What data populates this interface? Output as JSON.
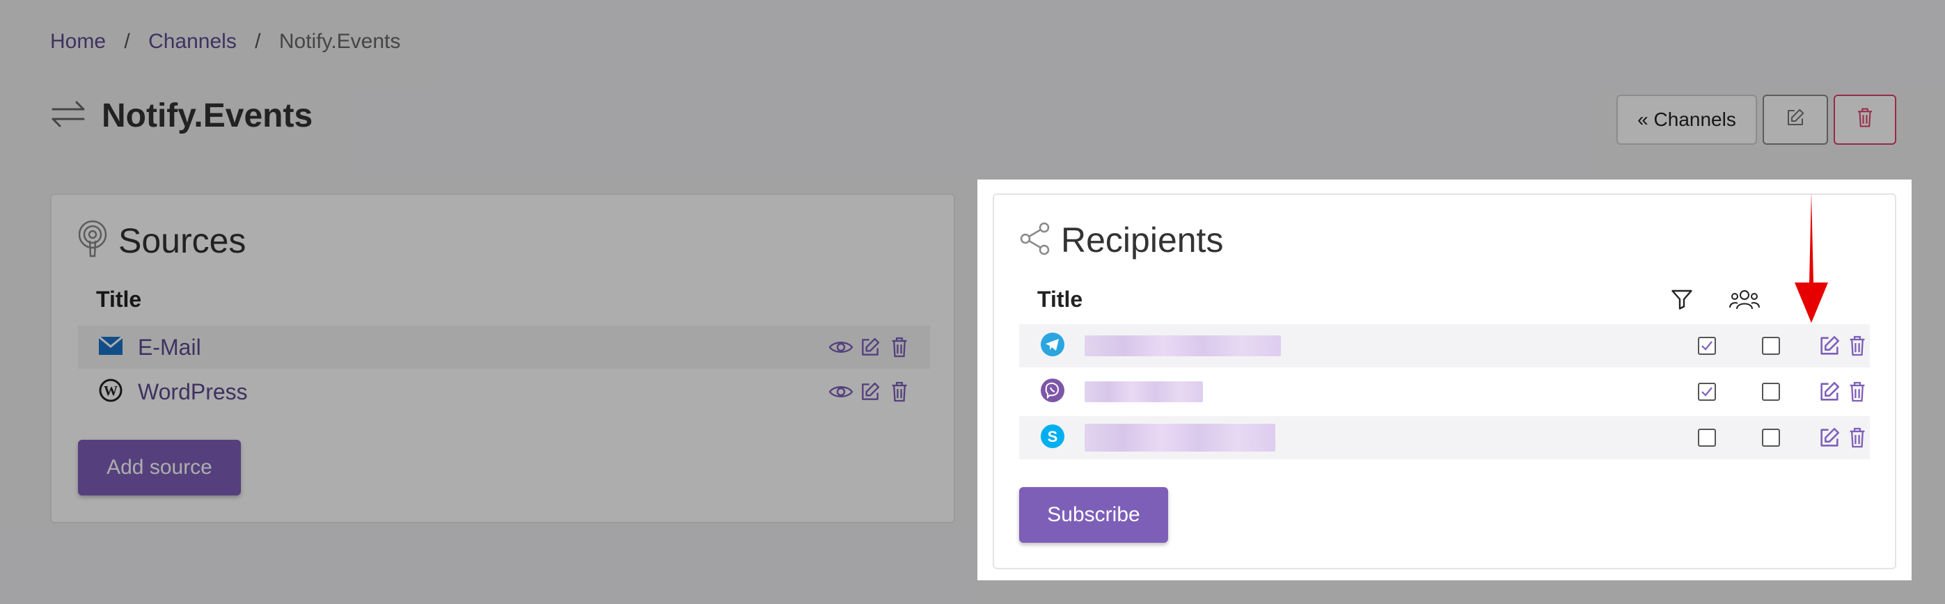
{
  "breadcrumb": {
    "home": "Home",
    "channels": "Channels",
    "current": "Notify.Events",
    "sep": "/"
  },
  "page": {
    "title": "Notify.Events",
    "icon": "arrows-exchange-icon"
  },
  "toolbar": {
    "channels_label": "« Channels",
    "edit_icon": "edit-icon",
    "delete_icon": "trash-icon",
    "delete_color": "#e0406a"
  },
  "sources": {
    "title": "Sources",
    "column_title": "Title",
    "items": [
      {
        "label": "E-Mail",
        "icon": "email-icon"
      },
      {
        "label": "WordPress",
        "icon": "wordpress-icon"
      }
    ],
    "add_label": "Add source"
  },
  "recipients": {
    "title": "Recipients",
    "column_title": "Title",
    "items": [
      {
        "service": "telegram-icon",
        "filter_checked": true,
        "group_checked": false
      },
      {
        "service": "viber-icon",
        "filter_checked": true,
        "group_checked": false
      },
      {
        "service": "skype-icon",
        "filter_checked": false,
        "group_checked": false
      }
    ],
    "subscribe_label": "Subscribe"
  },
  "colors": {
    "accent": "#7e5fb8",
    "link": "#5e4a8e",
    "annotation_arrow": "#e60000"
  }
}
